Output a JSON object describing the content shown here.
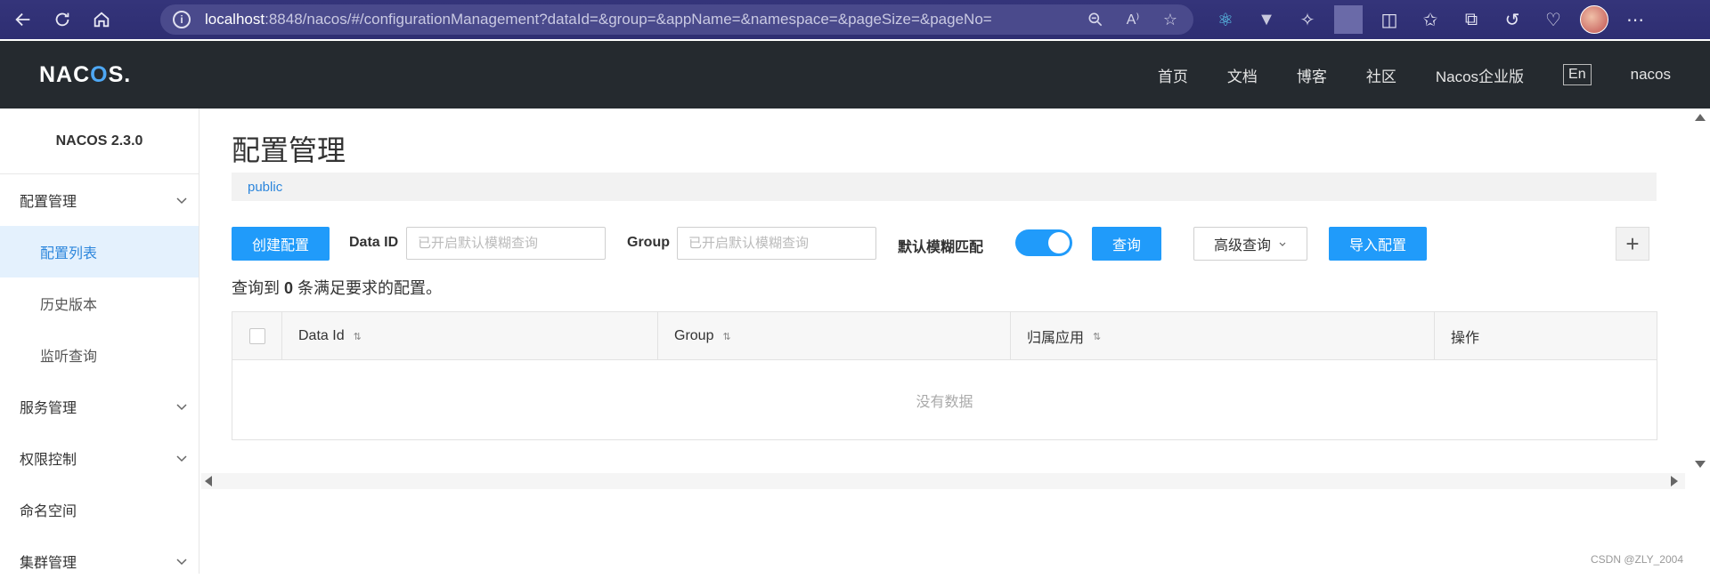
{
  "browser": {
    "url_host": "localhost",
    "url_rest": ":8848/nacos/#/configurationManagement?dataId=&group=&appName=&namespace=&pageSize=&pageNo="
  },
  "header": {
    "logo_main": "NAC",
    "logo_accent": "O",
    "logo_end": "S.",
    "nav": [
      "首页",
      "文档",
      "博客",
      "社区",
      "Nacos企业版"
    ],
    "lang": "En",
    "user": "nacos"
  },
  "sidebar": {
    "version": "NACOS 2.3.0",
    "items": [
      {
        "label": "配置管理",
        "type": "group"
      },
      {
        "label": "配置列表",
        "type": "sub",
        "active": true
      },
      {
        "label": "历史版本",
        "type": "sub"
      },
      {
        "label": "监听查询",
        "type": "sub"
      },
      {
        "label": "服务管理",
        "type": "group"
      },
      {
        "label": "权限控制",
        "type": "group"
      },
      {
        "label": "命名空间",
        "type": "item"
      },
      {
        "label": "集群管理",
        "type": "group"
      }
    ]
  },
  "main": {
    "title": "配置管理",
    "namespace": "public",
    "create_button": "创建配置",
    "data_id_label": "Data ID",
    "data_id_placeholder": "已开启默认模糊查询",
    "group_label": "Group",
    "group_placeholder": "已开启默认模糊查询",
    "fuzzy_label": "默认模糊匹配",
    "fuzzy_enabled": true,
    "query_button": "查询",
    "advanced_button": "高级查询",
    "import_button": "导入配置",
    "result_prefix": "查询到",
    "result_count": "0",
    "result_suffix": "条满足要求的配置。",
    "columns": [
      "Data Id",
      "Group",
      "归属应用",
      "操作"
    ],
    "empty_text": "没有数据"
  },
  "watermark": "CSDN @ZLY_2004",
  "colors": {
    "accent": "#209bfa",
    "header_bg": "#252a2f",
    "browser_bg": "#2e2e72"
  }
}
